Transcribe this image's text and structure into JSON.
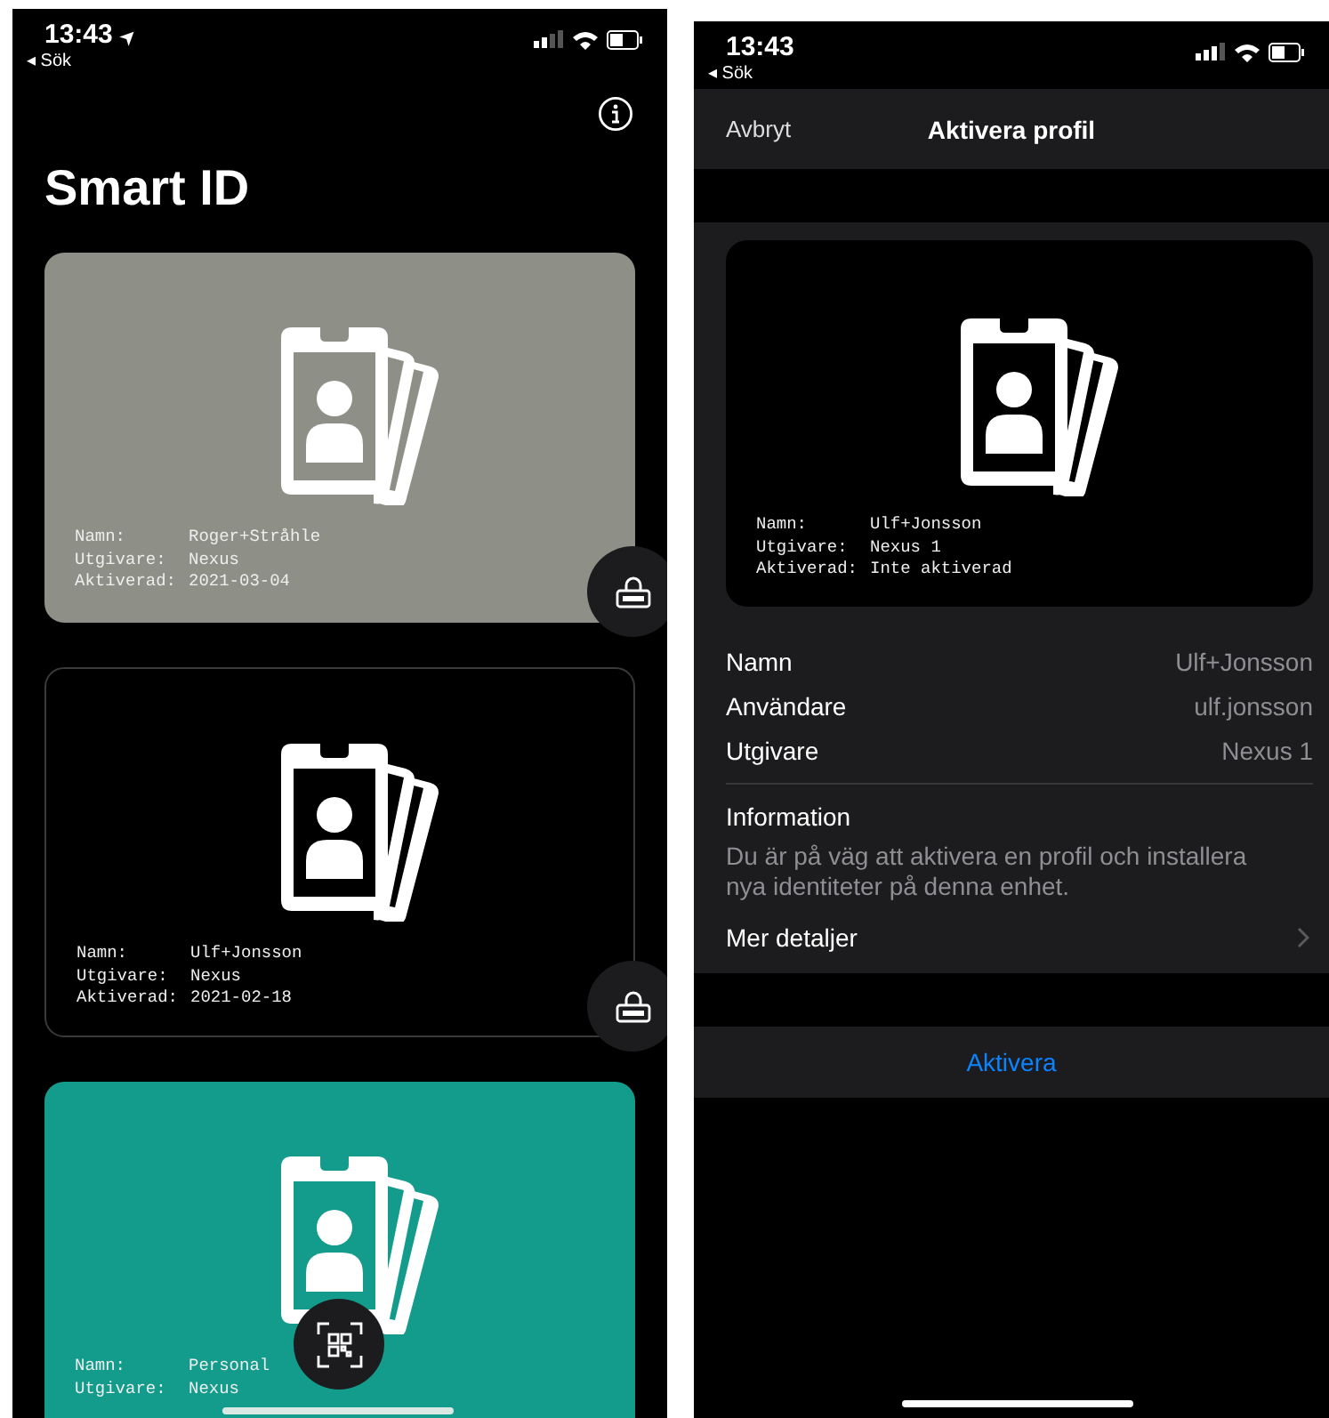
{
  "wallet_screen": {
    "status_bar": {
      "time": "13:43",
      "location_arrow": "➤",
      "back_label": "◂ Sök"
    },
    "title": "Smart ID",
    "cards": [
      {
        "color": "#8e8f86",
        "bordered": false,
        "lock_button": true,
        "fields": [
          {
            "label": "Namn:",
            "value": "Roger+Stråhle"
          },
          {
            "label": "Utgivare:",
            "value": "Nexus"
          },
          {
            "label": "Aktiverad:",
            "value": "2021-03-04"
          }
        ]
      },
      {
        "color": "#000000",
        "bordered": true,
        "lock_button": true,
        "fields": [
          {
            "label": "Namn:",
            "value": "Ulf+Jonsson"
          },
          {
            "label": "Utgivare:",
            "value": "Nexus"
          },
          {
            "label": "Aktiverad:",
            "value": "2021-02-18"
          }
        ]
      },
      {
        "color": "#139b8b",
        "bordered": false,
        "lock_button": false,
        "fields": [
          {
            "label": "Namn:",
            "value": "Personal"
          },
          {
            "label": "Utgivare:",
            "value": "Nexus"
          }
        ]
      }
    ]
  },
  "activate_screen": {
    "status_bar": {
      "time": "13:43",
      "back_label": "◂ Sök"
    },
    "nav": {
      "cancel": "Avbryt",
      "title": "Aktivera profil"
    },
    "card": {
      "color": "#000000",
      "fields": [
        {
          "label": "Namn:",
          "value": "Ulf+Jonsson"
        },
        {
          "label": "Utgivare:",
          "value": "Nexus 1"
        },
        {
          "label": "Aktiverad:",
          "value": "Inte aktiverad"
        }
      ]
    },
    "details": [
      {
        "label": "Namn",
        "value": "Ulf+Jonsson"
      },
      {
        "label": "Användare",
        "value": "ulf.jonsson"
      },
      {
        "label": "Utgivare",
        "value": "Nexus 1"
      }
    ],
    "information": {
      "heading": "Information",
      "text": "Du är på väg att aktivera en profil och installera nya identiteter på denna enhet."
    },
    "more_details": "Mer detaljer",
    "activate_button": "Aktivera"
  }
}
